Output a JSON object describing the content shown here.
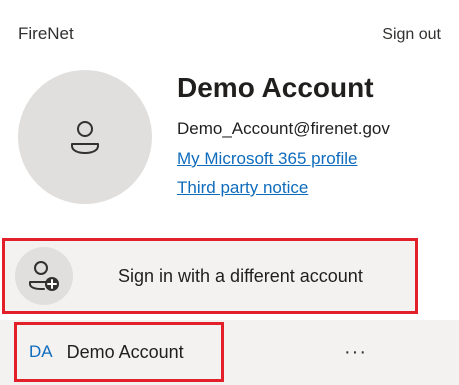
{
  "header": {
    "org_name": "FireNet",
    "sign_out": "Sign out"
  },
  "profile": {
    "name": "Demo Account",
    "email": "Demo_Account@firenet.gov",
    "profile_link": "My Microsoft 365 profile",
    "notice_link": "Third party notice",
    "avatar_icon": "person-icon"
  },
  "other_account": {
    "label": "Sign in with a different account",
    "icon": "person-add-icon"
  },
  "accounts": {
    "initials": "DA",
    "name": "Demo Account",
    "more": "···"
  },
  "colors": {
    "link": "#0f6cbd",
    "highlight": "#e3202a",
    "panel": "#f3f2f1"
  }
}
